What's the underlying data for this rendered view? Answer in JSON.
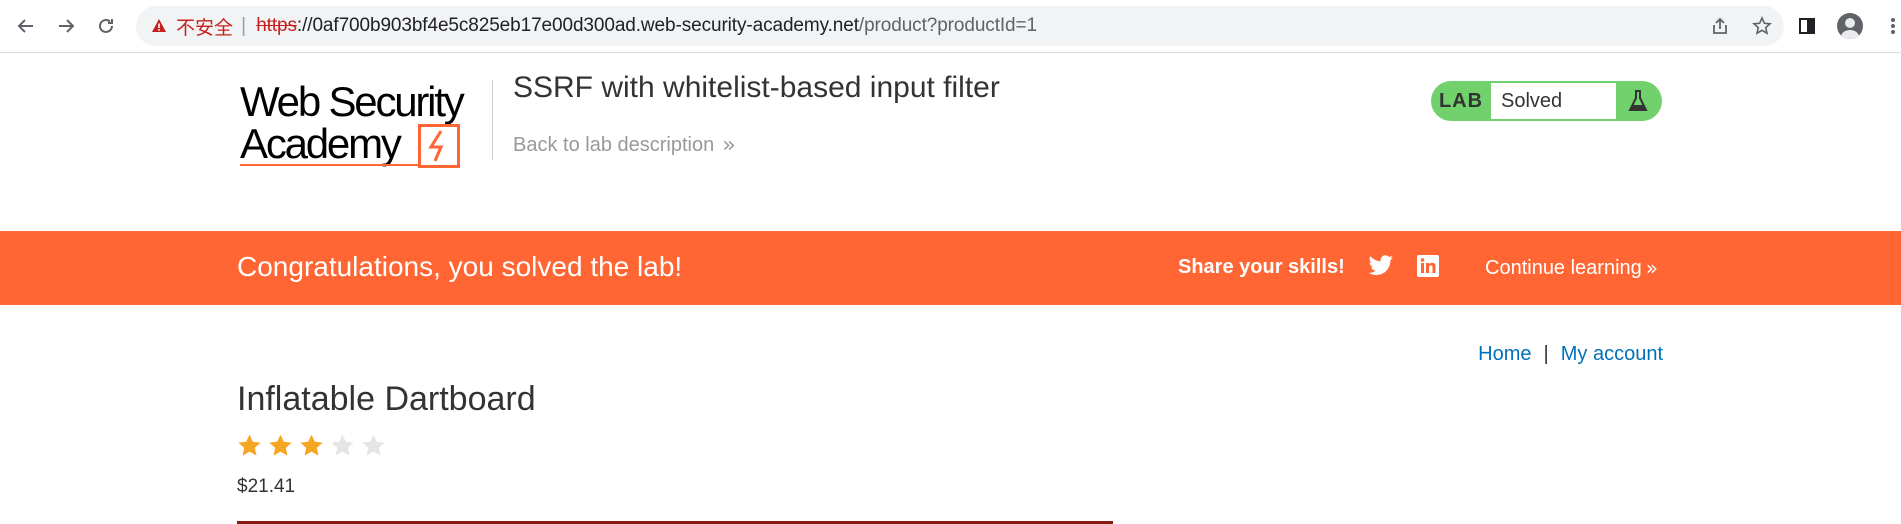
{
  "browser": {
    "security_label": "不安全",
    "url_scheme": "https",
    "url_host": "://0af700b903bf4e5c825eb17e00d300ad.web-security-academy.net",
    "url_path": "/product?productId=1"
  },
  "header": {
    "logo_line1": "Web Security",
    "logo_line2": "Academy",
    "lab_title": "SSRF with whitelist-based input filter",
    "back_link": "Back to lab description",
    "lab_tag": "LAB",
    "lab_state": "Solved",
    "lab_state_color": "#70d16d"
  },
  "banner": {
    "congrats": "Congratulations, you solved the lab!",
    "share_label": "Share your skills!",
    "continue_label": "Continue learning",
    "color": "#ff6633"
  },
  "nav": {
    "home": "Home",
    "separator": "|",
    "my_account": "My account"
  },
  "product": {
    "title": "Inflatable Dartboard",
    "rating": 3,
    "rating_max": 5,
    "price": "$21.41"
  }
}
